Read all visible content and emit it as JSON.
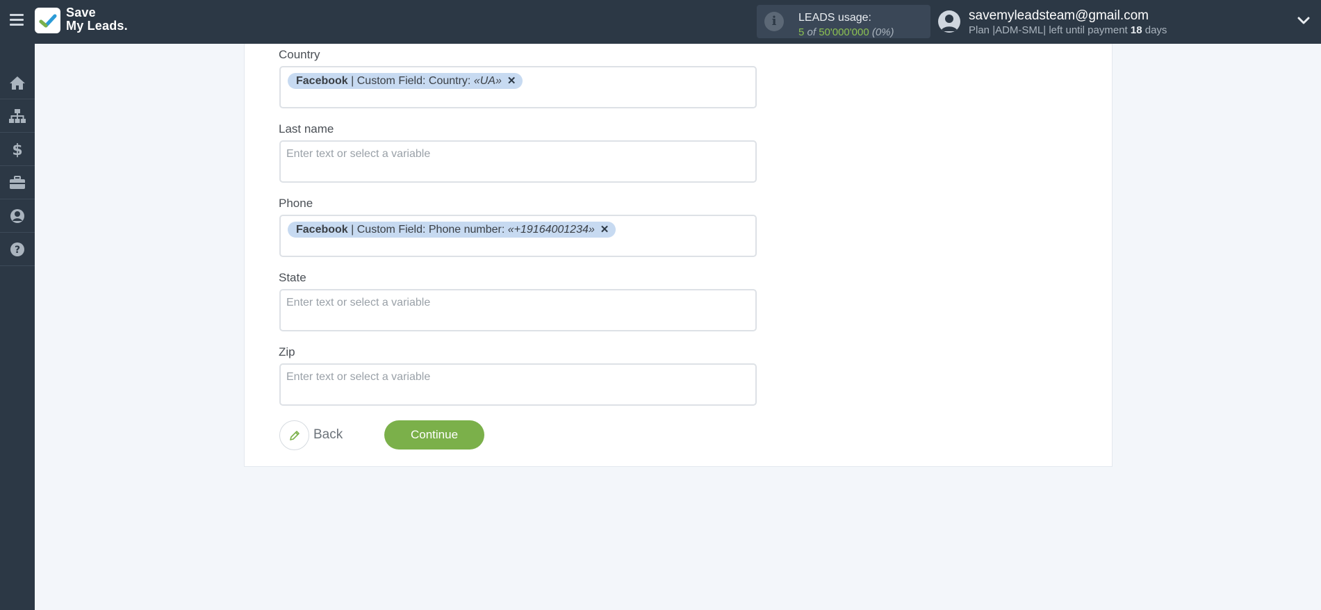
{
  "header": {
    "logo_line1": "Save",
    "logo_line2": "My Leads.",
    "usage_title": "LEADS usage:",
    "usage_used": "5",
    "usage_of": "of",
    "usage_total": "50'000'000",
    "usage_pct": "(0%)",
    "email": "savemyleadsteam@gmail.com",
    "plan_prefix": "Plan |ADM-SML| left until payment",
    "plan_days": "18",
    "plan_suffix": "days"
  },
  "sidebar": {
    "items": [
      {
        "icon": "home-icon"
      },
      {
        "icon": "sitemap-icon"
      },
      {
        "icon": "dollar-icon"
      },
      {
        "icon": "briefcase-icon"
      },
      {
        "icon": "user-circle-icon"
      },
      {
        "icon": "question-circle-icon"
      }
    ]
  },
  "form": {
    "country": {
      "label": "Country",
      "tag_source": "Facebook",
      "tag_field": "| Custom Field: Country:",
      "tag_value": "«UA»"
    },
    "last_name": {
      "label": "Last name",
      "placeholder": "Enter text or select a variable"
    },
    "phone": {
      "label": "Phone",
      "tag_source": "Facebook",
      "tag_field": "| Custom Field: Phone number:",
      "tag_value": "«+19164001234»"
    },
    "state": {
      "label": "State",
      "placeholder": "Enter text or select a variable"
    },
    "zip": {
      "label": "Zip",
      "placeholder": "Enter text or select a variable"
    },
    "back_label": "Back",
    "continue_label": "Continue"
  },
  "colors": {
    "topbar": "#2c3845",
    "accent_green": "#7bb04a",
    "tag_bg": "#c7daf1"
  }
}
